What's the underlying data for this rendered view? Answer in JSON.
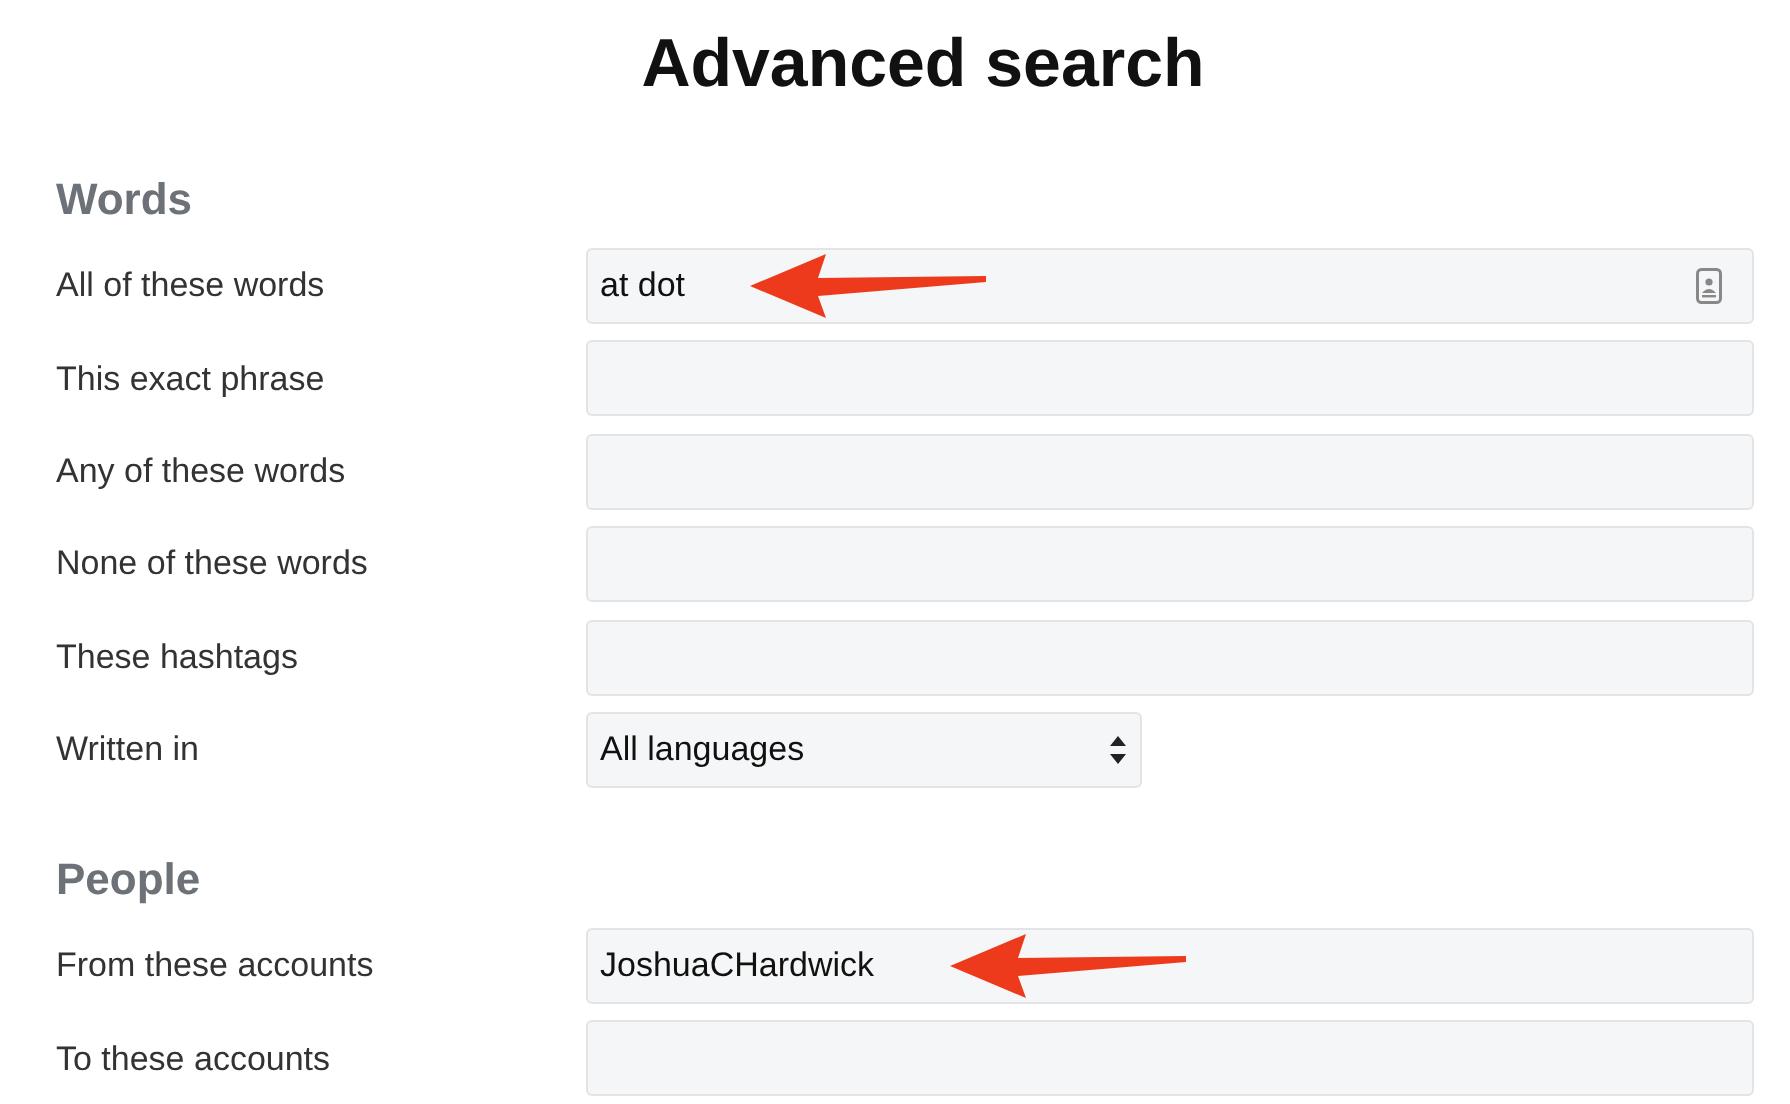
{
  "title": "Advanced search",
  "sections": [
    {
      "heading": "Words",
      "rows": [
        {
          "label": "All of these words",
          "kind": "text",
          "value": "at dot",
          "contact_icon": true,
          "annotated": true
        },
        {
          "label": "This exact phrase",
          "kind": "text",
          "contact_icon": false,
          "annotated": false
        },
        {
          "label": "Any of these words",
          "kind": "text",
          "contact_icon": false,
          "annotated": false
        },
        {
          "label": "None of these words",
          "kind": "text",
          "contact_icon": false,
          "annotated": false
        },
        {
          "label": "These hashtags",
          "kind": "text",
          "contact_icon": false,
          "annotated": false
        },
        {
          "label": "Written in",
          "kind": "select",
          "value": "All languages",
          "annotated": false
        }
      ]
    },
    {
      "heading": "People",
      "rows": [
        {
          "label": "From these accounts",
          "kind": "text",
          "value": "JoshuaCHardwick",
          "contact_icon": false,
          "annotated": true
        },
        {
          "label": "To these accounts",
          "kind": "text",
          "contact_icon": false,
          "annotated": false
        }
      ]
    }
  ]
}
